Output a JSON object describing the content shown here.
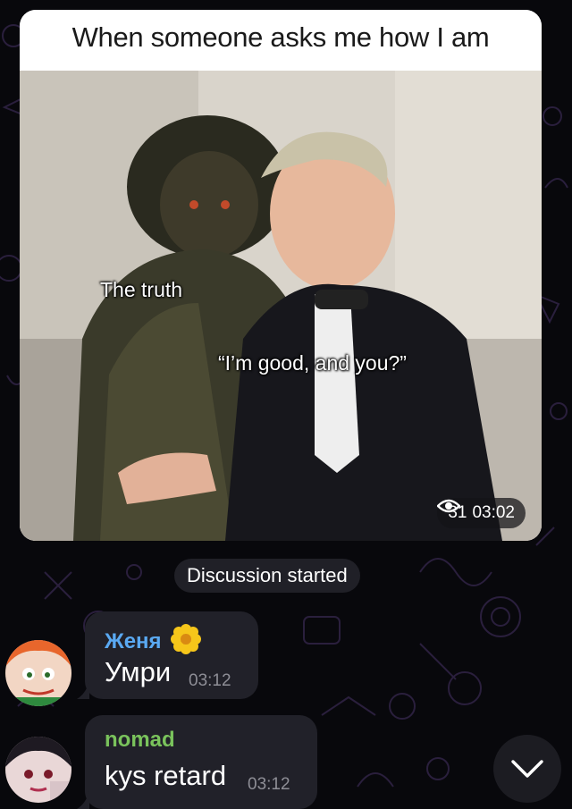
{
  "post": {
    "caption": "When someone asks me how I am",
    "label_truth": "The truth",
    "label_good": "“I’m good, and you?”",
    "views": "31",
    "time": "03:02"
  },
  "service_message": "Discussion started",
  "comments": [
    {
      "sender": "Женя",
      "sender_color": "#5aa9f2",
      "text": "Умри",
      "time": "03:12"
    },
    {
      "sender": "nomad",
      "sender_color": "#7ac35c",
      "text": "kys retard",
      "time": "03:12"
    }
  ],
  "icons": {
    "views": "eye-icon",
    "sender_emoji": "flower-icon",
    "scroll": "chevron-down-icon"
  },
  "colors": {
    "background": "#08080c",
    "bubble": "#212129"
  }
}
